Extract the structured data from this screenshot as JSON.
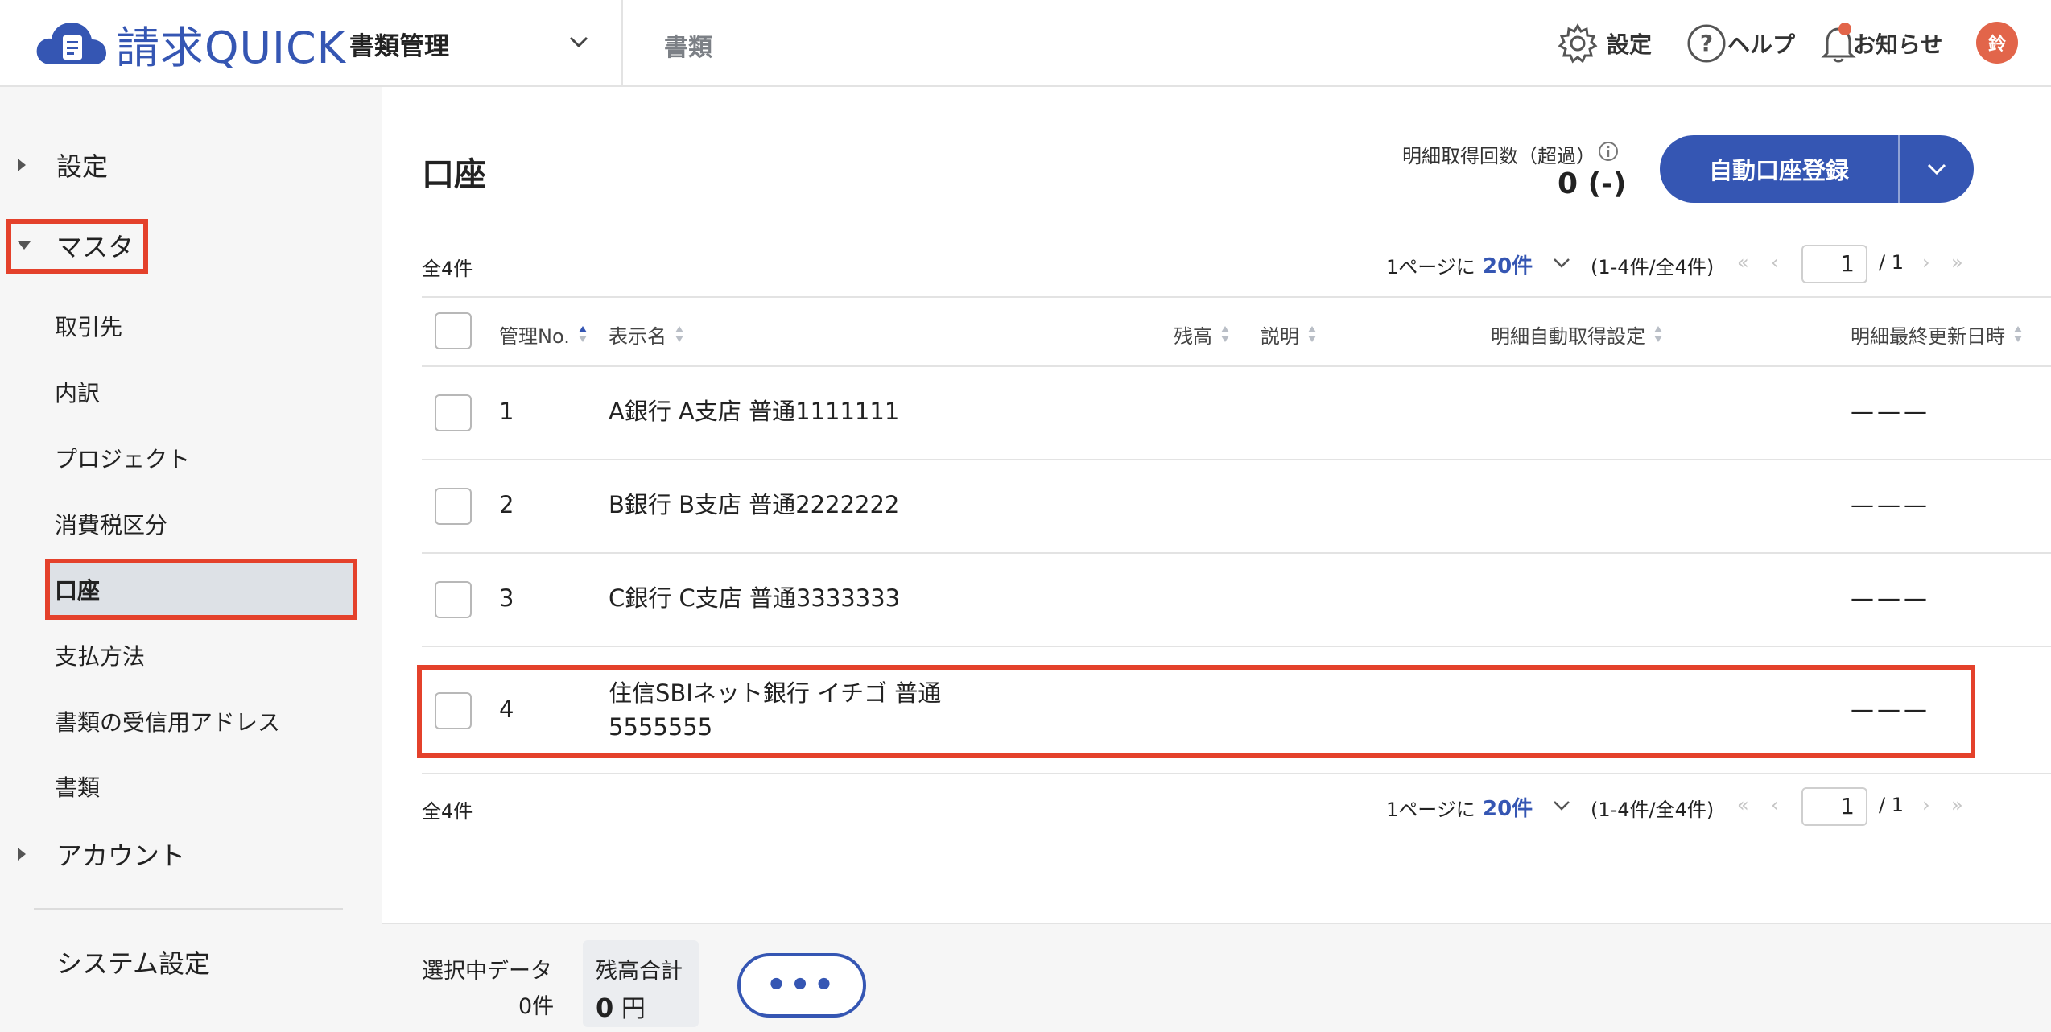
{
  "header": {
    "logo_text": "請求QUICK",
    "app_name": "書類管理",
    "section": "書類",
    "settings_label": "設定",
    "help_label": "ヘルプ",
    "notifications_label": "お知らせ",
    "avatar_initial": "鈴",
    "brand_color": "#3556b3",
    "accent_color": "#e2654a"
  },
  "sidebar": {
    "groups": [
      {
        "label": "設定",
        "expanded": false
      },
      {
        "label": "マスタ",
        "expanded": true
      },
      {
        "label": "アカウント",
        "expanded": false
      }
    ],
    "items": [
      {
        "label": "取引先"
      },
      {
        "label": "内訳"
      },
      {
        "label": "プロジェクト"
      },
      {
        "label": "消費税区分"
      },
      {
        "label": "口座",
        "active": true
      },
      {
        "label": "支払方法"
      },
      {
        "label": "書類の受信用アドレス"
      },
      {
        "label": "書類"
      }
    ],
    "system_settings": "システム設定"
  },
  "main": {
    "title": "口座",
    "usage_label": "明細取得回数（超過）",
    "usage_value": "0 (-)",
    "primary_button": "自動口座登録",
    "total_count": "全4件",
    "per_page_label": "1ページに",
    "per_page_value": "20件",
    "range": "(1-4件/全4件)",
    "current_page": "1",
    "total_pages": "/ 1",
    "table": {
      "headers": [
        "管理No.",
        "表示名",
        "残高",
        "説明",
        "明細自動取得設定",
        "明細最終更新日時"
      ],
      "rows": [
        {
          "no": "1",
          "name": "A銀行 A支店 普通1111111",
          "updated": "———"
        },
        {
          "no": "2",
          "name": "B銀行 B支店 普通2222222",
          "updated": "———"
        },
        {
          "no": "3",
          "name": "C銀行 C支店 普通3333333",
          "updated": "———"
        },
        {
          "no": "4",
          "name": "住信SBIネット銀行 イチゴ 普通5555555",
          "updated": "———"
        }
      ]
    }
  },
  "footer": {
    "selected_label": "選択中データ",
    "selected_value": "0件",
    "balance_label": "残高合計",
    "balance_amount": "0",
    "balance_unit": "円",
    "more_label": "•••"
  }
}
